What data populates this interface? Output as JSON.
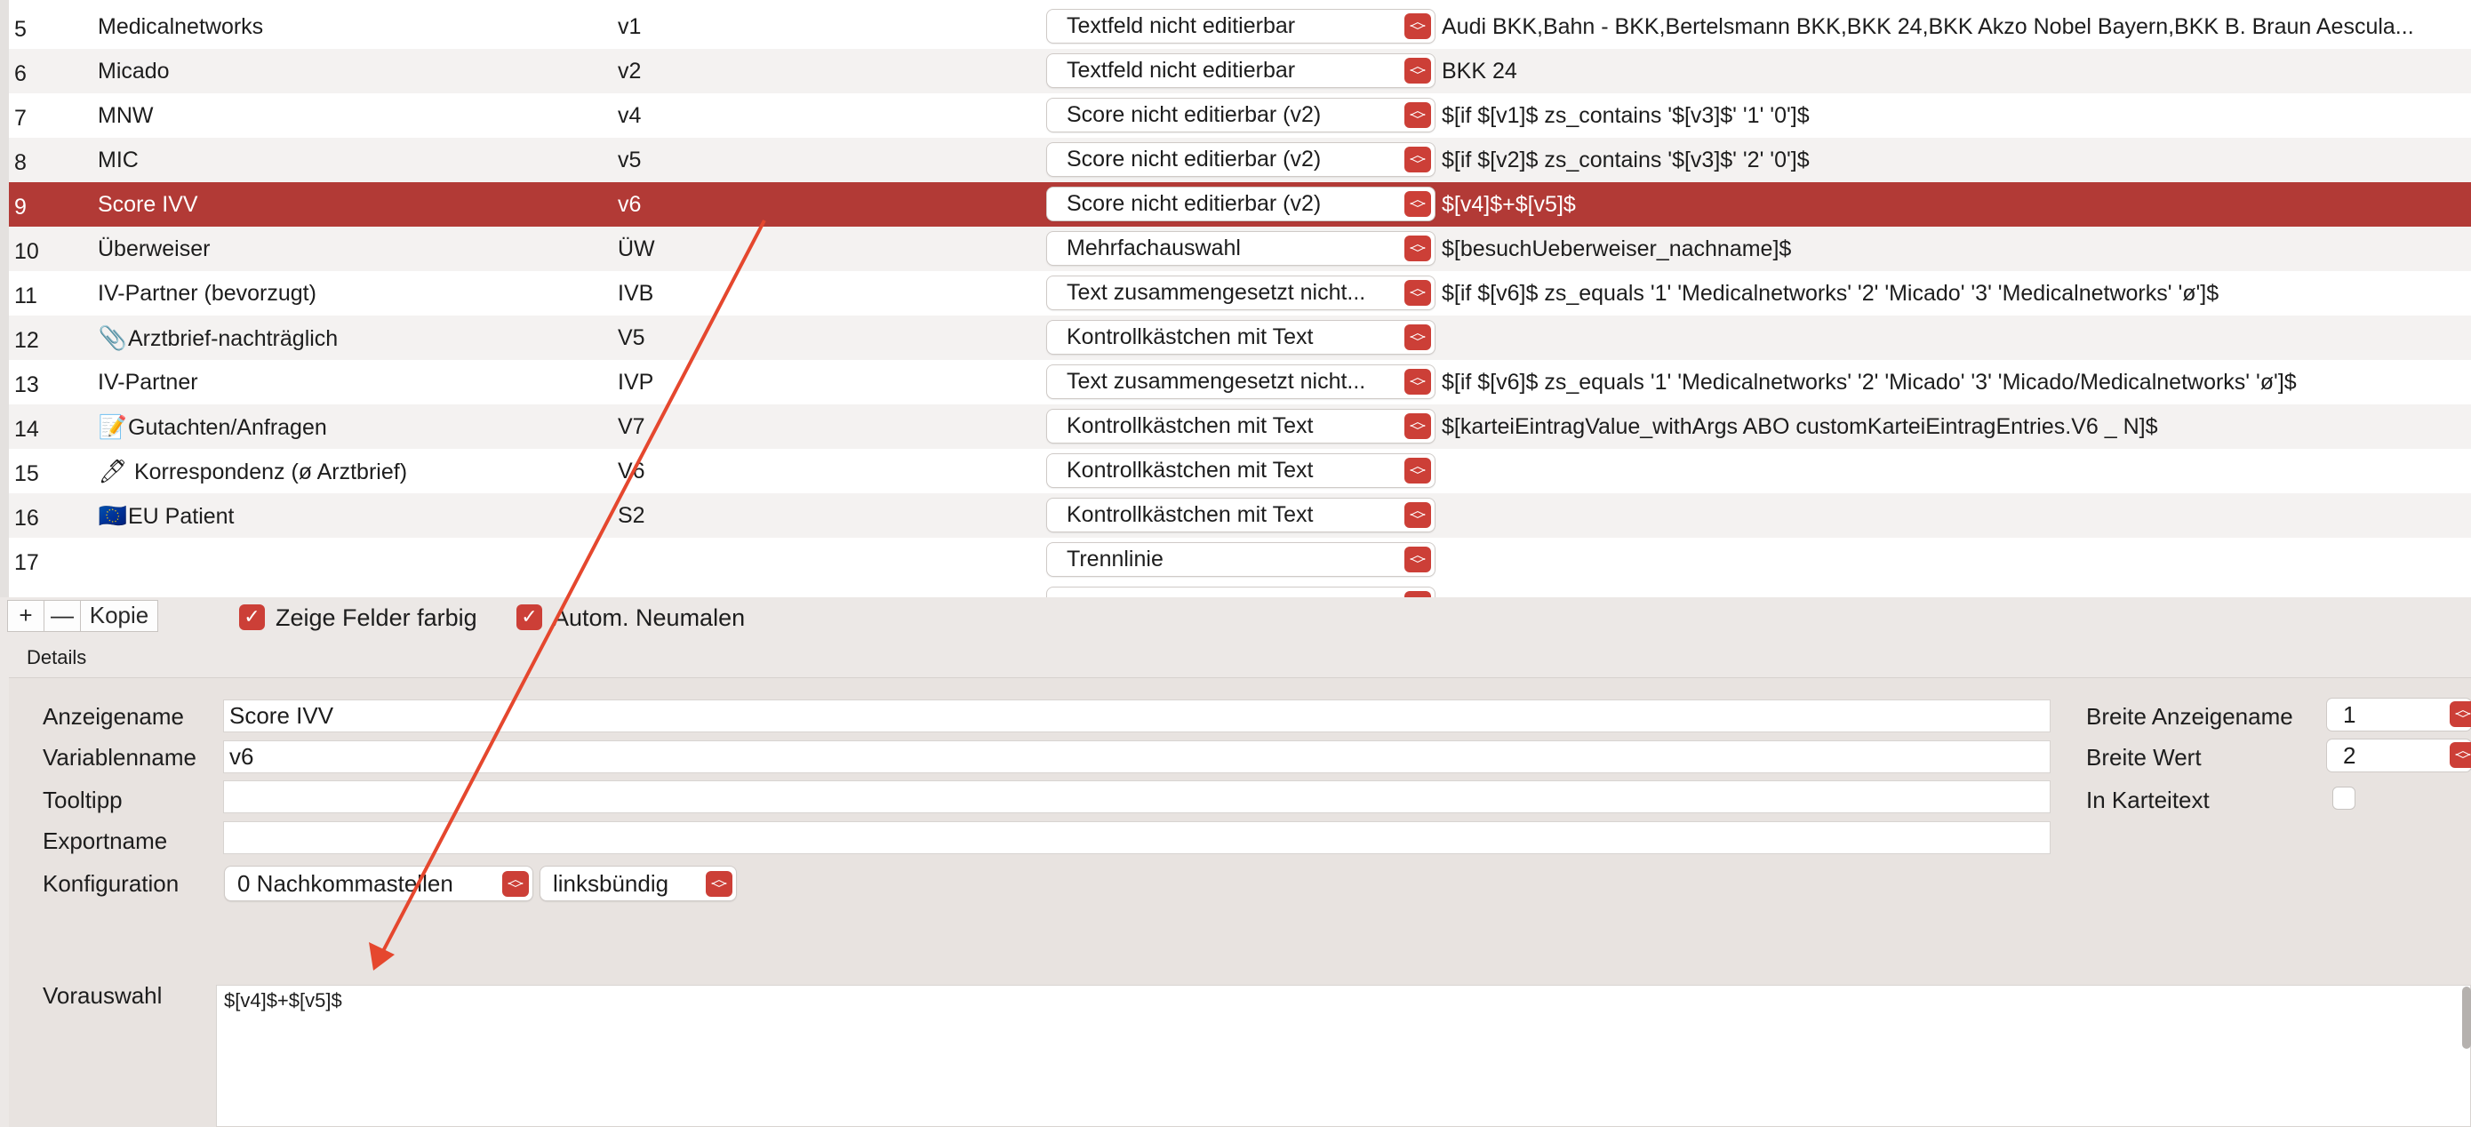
{
  "table": {
    "rows": [
      {
        "num": "5",
        "icon": "",
        "name": "Medicalnetworks",
        "var": "v1",
        "type": "Textfeld nicht editierbar",
        "expr": "Audi BKK,Bahn - BKK,Bertelsmann BKK,BKK 24,BKK Akzo Nobel Bayern,BKK B. Braun Aescula..."
      },
      {
        "num": "6",
        "icon": "",
        "name": "Micado",
        "var": "v2",
        "type": "Textfeld nicht editierbar",
        "expr": "BKK 24"
      },
      {
        "num": "7",
        "icon": "",
        "name": "MNW",
        "var": "v4",
        "type": "Score nicht editierbar (v2)",
        "expr": "$[if $[v1]$ zs_contains '$[v3]$' '1' '0']$"
      },
      {
        "num": "8",
        "icon": "",
        "name": "MIC",
        "var": "v5",
        "type": "Score nicht editierbar (v2)",
        "expr": "$[if $[v2]$ zs_contains '$[v3]$' '2' '0']$"
      },
      {
        "num": "9",
        "icon": "",
        "name": "Score IVV",
        "var": "v6",
        "type": "Score nicht editierbar (v2)",
        "expr": "$[v4]$+$[v5]$"
      },
      {
        "num": "10",
        "icon": "",
        "name": "Überweiser",
        "var": "ÜW",
        "type": "Mehrfachauswahl",
        "expr": "$[besuchUeberweiser_nachname]$"
      },
      {
        "num": "11",
        "icon": "",
        "name": "IV-Partner (bevorzugt)",
        "var": "IVB",
        "type": "Text zusammengesetzt nicht...",
        "expr": "$[if $[v6]$ zs_equals '1' 'Medicalnetworks' '2' 'Micado' '3' 'Medicalnetworks' 'ø']$"
      },
      {
        "num": "12",
        "icon": "📎",
        "name": "Arztbrief-nachträglich",
        "var": "V5",
        "type": "Kontrollkästchen mit Text",
        "expr": ""
      },
      {
        "num": "13",
        "icon": "",
        "name": "IV-Partner",
        "var": "IVP",
        "type": "Text zusammengesetzt nicht...",
        "expr": "$[if $[v6]$ zs_equals '1' 'Medicalnetworks' '2' 'Micado' '3' 'Micado/Medicalnetworks' 'ø']$"
      },
      {
        "num": "14",
        "icon": "📝",
        "name": "Gutachten/Anfragen",
        "var": "V7",
        "type": "Kontrollkästchen mit Text",
        "expr": "$[karteiEintragValue_withArgs ABO customKarteiEintragEntries.V6 _ N]$"
      },
      {
        "num": "15",
        "icon": "🖊",
        "name": " Korrespondenz (ø Arztbrief)",
        "var": "V6",
        "type": "Kontrollkästchen mit Text",
        "expr": ""
      },
      {
        "num": "16",
        "icon": "🇪🇺",
        "name": "EU Patient",
        "var": "S2",
        "type": "Kontrollkästchen mit Text",
        "expr": ""
      },
      {
        "num": "17",
        "icon": "",
        "name": "",
        "var": "",
        "type": "Trennlinie",
        "expr": ""
      }
    ],
    "selected_row_num": "9"
  },
  "toolbar": {
    "add_label": "+",
    "remove_label": "—",
    "copy_label": "Kopie",
    "show_colored_label": "Zeige Felder farbig",
    "show_colored_checked": true,
    "auto_repaint_label": "Autom. Neumalen",
    "auto_repaint_checked": true
  },
  "details": {
    "section_label": "Details",
    "anzeigename_label": "Anzeigename",
    "anzeigename_value": "Score IVV",
    "variablenname_label": "Variablenname",
    "variablenname_value": "v6",
    "tooltipp_label": "Tooltipp",
    "tooltipp_value": "",
    "exportname_label": "Exportname",
    "exportname_value": "",
    "konfiguration_label": "Konfiguration",
    "nachkommastellen_value": "0 Nachkommastellen",
    "alignment_value": "linksbündig",
    "breite_anzeigename_label": "Breite Anzeigename",
    "breite_anzeigename_value": "1",
    "breite_wert_label": "Breite Wert",
    "breite_wert_value": "2",
    "in_karteitext_label": "In Karteitext",
    "in_karteitext_checked": false,
    "vorauswahl_label": "Vorauswahl",
    "vorauswahl_value": "$[v4]$+$[v5]$"
  },
  "colors": {
    "accent": "#cc3f37",
    "selected_row": "#b23a36",
    "annotation_arrow": "#e5472e"
  },
  "annotation": {
    "type": "arrow",
    "from": "selected-row-variable",
    "to": "vorauswahl-field"
  }
}
